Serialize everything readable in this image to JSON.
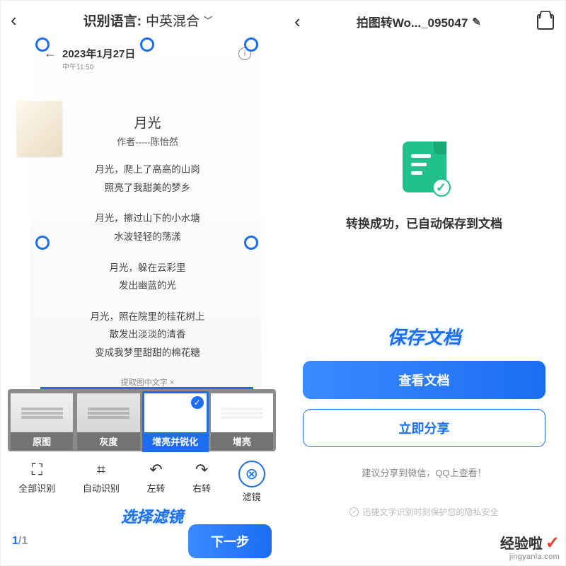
{
  "left": {
    "header": {
      "lang_label": "识别语言:",
      "lang_value": "中英混合"
    },
    "doc": {
      "date": "2023年1月27日",
      "time": "中午11:50",
      "title": "月光",
      "author": "作者-----陈怡然",
      "p1a": "月光，爬上了高高的山岗",
      "p1b": "照亮了我甜美的梦乡",
      "p2a": "月光，擦过山下的小水塘",
      "p2b": "水波轻轻的荡漾",
      "p3a": "月光，躲在云彩里",
      "p3b": "发出幽蓝的光",
      "p4a": "月光，照在院里的桂花树上",
      "p4b": "散发出淡淡的清香",
      "p4c": "变成我梦里甜甜的棉花糖",
      "extract": "提取图中文字 ×"
    },
    "filters": {
      "f1": "原图",
      "f2": "灰度",
      "f3": "增亮并锐化",
      "f4": "增亮"
    },
    "toolbar": {
      "t1": "全部识别",
      "t2": "自动识别",
      "t3": "左转",
      "t4": "右转",
      "t5": "滤镜"
    },
    "annotation": "选择滤镜",
    "page_current": "1",
    "page_total": "1",
    "next": "下一步"
  },
  "right": {
    "title": "拍图转Wo..._095047",
    "success": "转换成功，已自动保存到文档",
    "annotation": "保存文档",
    "view_btn": "查看文档",
    "share_btn": "立即分享",
    "tip": "建议分享到微信，QQ上查看！",
    "privacy": "迅捷文字识别时刻保护您的隐私安全"
  },
  "watermark": {
    "brand": "经验啦",
    "url": "jingyanla.com"
  }
}
